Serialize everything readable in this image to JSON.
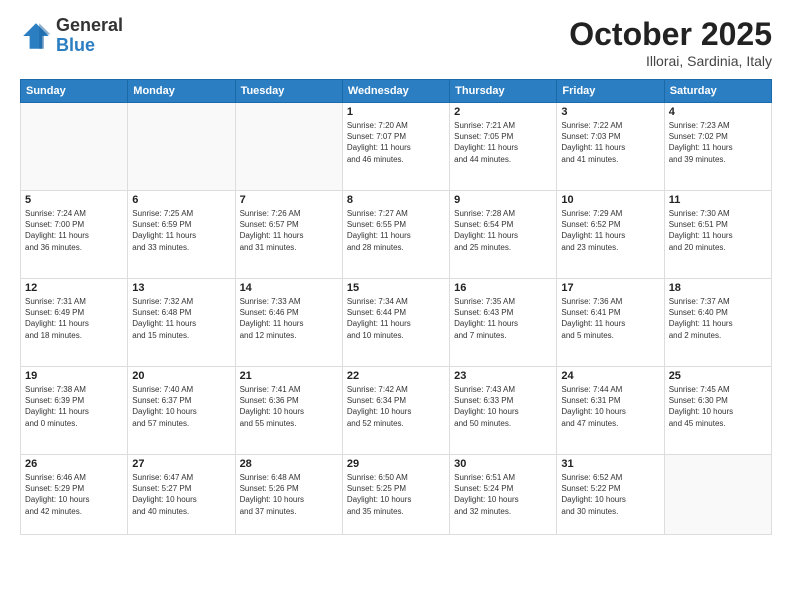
{
  "header": {
    "logo_general": "General",
    "logo_blue": "Blue",
    "month_title": "October 2025",
    "location": "Illorai, Sardinia, Italy"
  },
  "weekdays": [
    "Sunday",
    "Monday",
    "Tuesday",
    "Wednesday",
    "Thursday",
    "Friday",
    "Saturday"
  ],
  "weeks": [
    [
      {
        "day": "",
        "info": ""
      },
      {
        "day": "",
        "info": ""
      },
      {
        "day": "",
        "info": ""
      },
      {
        "day": "1",
        "info": "Sunrise: 7:20 AM\nSunset: 7:07 PM\nDaylight: 11 hours\nand 46 minutes."
      },
      {
        "day": "2",
        "info": "Sunrise: 7:21 AM\nSunset: 7:05 PM\nDaylight: 11 hours\nand 44 minutes."
      },
      {
        "day": "3",
        "info": "Sunrise: 7:22 AM\nSunset: 7:03 PM\nDaylight: 11 hours\nand 41 minutes."
      },
      {
        "day": "4",
        "info": "Sunrise: 7:23 AM\nSunset: 7:02 PM\nDaylight: 11 hours\nand 39 minutes."
      }
    ],
    [
      {
        "day": "5",
        "info": "Sunrise: 7:24 AM\nSunset: 7:00 PM\nDaylight: 11 hours\nand 36 minutes."
      },
      {
        "day": "6",
        "info": "Sunrise: 7:25 AM\nSunset: 6:59 PM\nDaylight: 11 hours\nand 33 minutes."
      },
      {
        "day": "7",
        "info": "Sunrise: 7:26 AM\nSunset: 6:57 PM\nDaylight: 11 hours\nand 31 minutes."
      },
      {
        "day": "8",
        "info": "Sunrise: 7:27 AM\nSunset: 6:55 PM\nDaylight: 11 hours\nand 28 minutes."
      },
      {
        "day": "9",
        "info": "Sunrise: 7:28 AM\nSunset: 6:54 PM\nDaylight: 11 hours\nand 25 minutes."
      },
      {
        "day": "10",
        "info": "Sunrise: 7:29 AM\nSunset: 6:52 PM\nDaylight: 11 hours\nand 23 minutes."
      },
      {
        "day": "11",
        "info": "Sunrise: 7:30 AM\nSunset: 6:51 PM\nDaylight: 11 hours\nand 20 minutes."
      }
    ],
    [
      {
        "day": "12",
        "info": "Sunrise: 7:31 AM\nSunset: 6:49 PM\nDaylight: 11 hours\nand 18 minutes."
      },
      {
        "day": "13",
        "info": "Sunrise: 7:32 AM\nSunset: 6:48 PM\nDaylight: 11 hours\nand 15 minutes."
      },
      {
        "day": "14",
        "info": "Sunrise: 7:33 AM\nSunset: 6:46 PM\nDaylight: 11 hours\nand 12 minutes."
      },
      {
        "day": "15",
        "info": "Sunrise: 7:34 AM\nSunset: 6:44 PM\nDaylight: 11 hours\nand 10 minutes."
      },
      {
        "day": "16",
        "info": "Sunrise: 7:35 AM\nSunset: 6:43 PM\nDaylight: 11 hours\nand 7 minutes."
      },
      {
        "day": "17",
        "info": "Sunrise: 7:36 AM\nSunset: 6:41 PM\nDaylight: 11 hours\nand 5 minutes."
      },
      {
        "day": "18",
        "info": "Sunrise: 7:37 AM\nSunset: 6:40 PM\nDaylight: 11 hours\nand 2 minutes."
      }
    ],
    [
      {
        "day": "19",
        "info": "Sunrise: 7:38 AM\nSunset: 6:39 PM\nDaylight: 11 hours\nand 0 minutes."
      },
      {
        "day": "20",
        "info": "Sunrise: 7:40 AM\nSunset: 6:37 PM\nDaylight: 10 hours\nand 57 minutes."
      },
      {
        "day": "21",
        "info": "Sunrise: 7:41 AM\nSunset: 6:36 PM\nDaylight: 10 hours\nand 55 minutes."
      },
      {
        "day": "22",
        "info": "Sunrise: 7:42 AM\nSunset: 6:34 PM\nDaylight: 10 hours\nand 52 minutes."
      },
      {
        "day": "23",
        "info": "Sunrise: 7:43 AM\nSunset: 6:33 PM\nDaylight: 10 hours\nand 50 minutes."
      },
      {
        "day": "24",
        "info": "Sunrise: 7:44 AM\nSunset: 6:31 PM\nDaylight: 10 hours\nand 47 minutes."
      },
      {
        "day": "25",
        "info": "Sunrise: 7:45 AM\nSunset: 6:30 PM\nDaylight: 10 hours\nand 45 minutes."
      }
    ],
    [
      {
        "day": "26",
        "info": "Sunrise: 6:46 AM\nSunset: 5:29 PM\nDaylight: 10 hours\nand 42 minutes."
      },
      {
        "day": "27",
        "info": "Sunrise: 6:47 AM\nSunset: 5:27 PM\nDaylight: 10 hours\nand 40 minutes."
      },
      {
        "day": "28",
        "info": "Sunrise: 6:48 AM\nSunset: 5:26 PM\nDaylight: 10 hours\nand 37 minutes."
      },
      {
        "day": "29",
        "info": "Sunrise: 6:50 AM\nSunset: 5:25 PM\nDaylight: 10 hours\nand 35 minutes."
      },
      {
        "day": "30",
        "info": "Sunrise: 6:51 AM\nSunset: 5:24 PM\nDaylight: 10 hours\nand 32 minutes."
      },
      {
        "day": "31",
        "info": "Sunrise: 6:52 AM\nSunset: 5:22 PM\nDaylight: 10 hours\nand 30 minutes."
      },
      {
        "day": "",
        "info": ""
      }
    ]
  ]
}
